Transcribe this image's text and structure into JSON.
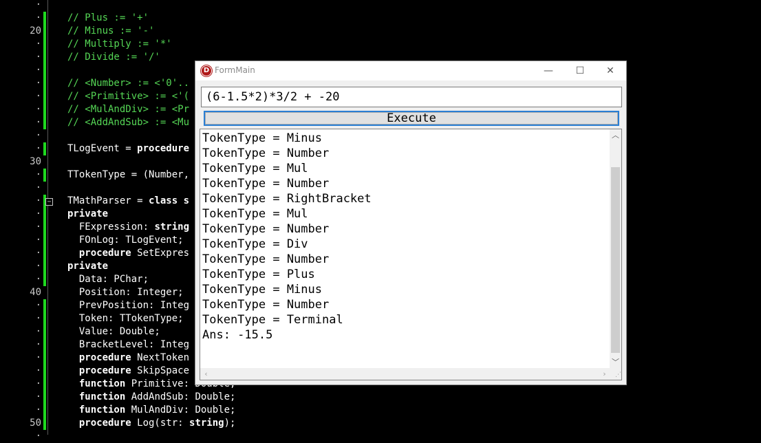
{
  "editor": {
    "line_numbers": [
      {
        "text": "·",
        "row": 0
      },
      {
        "text": "20",
        "row": 2
      },
      {
        "text": "30",
        "row": 12
      },
      {
        "text": "40",
        "row": 22
      },
      {
        "text": "50",
        "row": 32
      }
    ],
    "code_lines": [
      {
        "row": 1,
        "segments": [
          {
            "t": "// Plus := '+'",
            "c": "comment"
          }
        ]
      },
      {
        "row": 2,
        "segments": [
          {
            "t": "// Minus := '-'",
            "c": "comment"
          }
        ]
      },
      {
        "row": 3,
        "segments": [
          {
            "t": "// Multiply := '*'",
            "c": "comment"
          }
        ]
      },
      {
        "row": 4,
        "segments": [
          {
            "t": "// Divide := '/'",
            "c": "comment"
          }
        ]
      },
      {
        "row": 6,
        "segments": [
          {
            "t": "// <Number> := <'0'..",
            "c": "comment"
          }
        ]
      },
      {
        "row": 7,
        "segments": [
          {
            "t": "// <Primitive> := <'(",
            "c": "comment"
          }
        ]
      },
      {
        "row": 8,
        "segments": [
          {
            "t": "// <MulAndDiv> := <Pr",
            "c": "comment"
          }
        ]
      },
      {
        "row": 9,
        "segments": [
          {
            "t": "// <AddAndSub> := <Mu",
            "c": "comment"
          }
        ]
      },
      {
        "row": 11,
        "segments": [
          {
            "t": "TLogEvent = ",
            "c": ""
          },
          {
            "t": "procedure",
            "c": "kw"
          }
        ]
      },
      {
        "row": 13,
        "segments": [
          {
            "t": "TTokenType = (Number,",
            "c": ""
          }
        ]
      },
      {
        "row": 15,
        "segments": [
          {
            "t": "TMathParser = ",
            "c": ""
          },
          {
            "t": "class s",
            "c": "kw"
          }
        ]
      },
      {
        "row": 16,
        "segments": [
          {
            "t": "private",
            "c": "kw"
          }
        ]
      },
      {
        "row": 17,
        "segments": [
          {
            "t": "  FExpression: ",
            "c": ""
          },
          {
            "t": "string",
            "c": "kw"
          }
        ]
      },
      {
        "row": 18,
        "segments": [
          {
            "t": "  FOnLog: TLogEvent;",
            "c": ""
          }
        ]
      },
      {
        "row": 19,
        "segments": [
          {
            "t": "  ",
            "c": ""
          },
          {
            "t": "procedure",
            "c": "kw"
          },
          {
            "t": " SetExpres",
            "c": ""
          }
        ]
      },
      {
        "row": 20,
        "segments": [
          {
            "t": "private",
            "c": "kw"
          }
        ]
      },
      {
        "row": 21,
        "segments": [
          {
            "t": "  Data: PChar;",
            "c": ""
          }
        ]
      },
      {
        "row": 22,
        "segments": [
          {
            "t": "  Position: Integer;",
            "c": ""
          }
        ]
      },
      {
        "row": 23,
        "segments": [
          {
            "t": "  PrevPosition: Integ",
            "c": ""
          }
        ]
      },
      {
        "row": 24,
        "segments": [
          {
            "t": "  Token: TTokenType;",
            "c": ""
          }
        ]
      },
      {
        "row": 25,
        "segments": [
          {
            "t": "  Value: Double;",
            "c": ""
          }
        ]
      },
      {
        "row": 26,
        "segments": [
          {
            "t": "  BracketLevel: Integ",
            "c": ""
          }
        ]
      },
      {
        "row": 27,
        "segments": [
          {
            "t": "  ",
            "c": ""
          },
          {
            "t": "procedure",
            "c": "kw"
          },
          {
            "t": " NextToken",
            "c": ""
          }
        ]
      },
      {
        "row": 28,
        "segments": [
          {
            "t": "  ",
            "c": ""
          },
          {
            "t": "procedure",
            "c": "kw"
          },
          {
            "t": " SkipSpace",
            "c": ""
          }
        ]
      },
      {
        "row": 29,
        "segments": [
          {
            "t": "  ",
            "c": ""
          },
          {
            "t": "function",
            "c": "kw"
          },
          {
            "t": " Primitive: Double;",
            "c": ""
          }
        ]
      },
      {
        "row": 30,
        "segments": [
          {
            "t": "  ",
            "c": ""
          },
          {
            "t": "function",
            "c": "kw"
          },
          {
            "t": " AddAndSub: Double;",
            "c": ""
          }
        ]
      },
      {
        "row": 31,
        "segments": [
          {
            "t": "  ",
            "c": ""
          },
          {
            "t": "function",
            "c": "kw"
          },
          {
            "t": " MulAndDiv: Double;",
            "c": ""
          }
        ]
      },
      {
        "row": 32,
        "segments": [
          {
            "t": "  ",
            "c": ""
          },
          {
            "t": "procedure",
            "c": "kw"
          },
          {
            "t": " Log(str: ",
            "c": ""
          },
          {
            "t": "string",
            "c": "kw"
          },
          {
            "t": ");",
            "c": ""
          }
        ]
      }
    ]
  },
  "form": {
    "title": "FormMain",
    "icon_letter": "D",
    "minimize_glyph": "—",
    "maximize_glyph": "☐",
    "close_glyph": "✕",
    "expression_value": "(6-1.5*2)*3/2 + -20",
    "execute_label": "Execute",
    "output_lines": [
      "TokenType = Minus",
      "TokenType = Number",
      "TokenType = Mul",
      "TokenType = Number",
      "TokenType = RightBracket",
      "TokenType = Mul",
      "TokenType = Number",
      "TokenType = Div",
      "TokenType = Number",
      "TokenType = Plus",
      "TokenType = Minus",
      "TokenType = Number",
      "TokenType = Terminal",
      "Ans: -15.5"
    ]
  },
  "colors": {
    "editor_background": "#000000",
    "comment": "#55d655",
    "change_bar": "#1fd81f",
    "focus_border": "#2b7fd4"
  }
}
